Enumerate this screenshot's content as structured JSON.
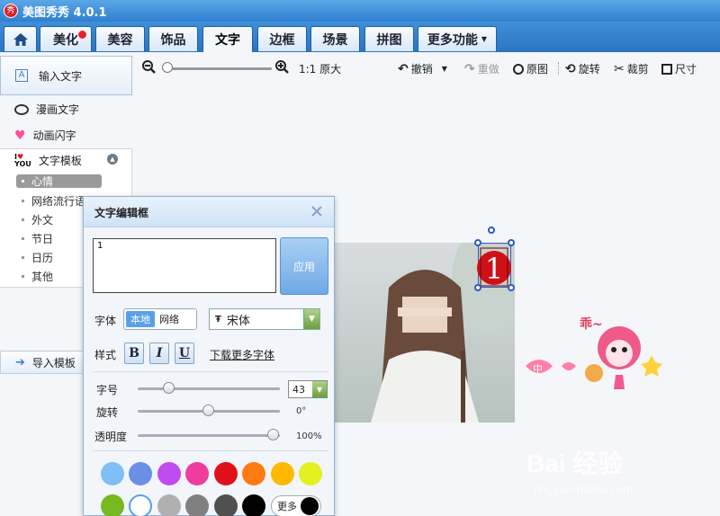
{
  "app": {
    "title": "美图秀秀 4.0.1",
    "logo_text": "秀"
  },
  "tabs": [
    {
      "label": ""
    },
    {
      "label": "美化"
    },
    {
      "label": "美容"
    },
    {
      "label": "饰品"
    },
    {
      "label": "文字"
    },
    {
      "label": "边框"
    },
    {
      "label": "场景"
    },
    {
      "label": "拼图"
    },
    {
      "label": "更多功能"
    }
  ],
  "toolbar": {
    "original_size": "1:1 原大",
    "undo": "撤销",
    "redo": "重做",
    "original": "原图",
    "rotate": "旋转",
    "crop": "裁剪",
    "resize": "尺寸",
    "zoom_level": 0.0
  },
  "left_panel": {
    "input_text": "输入文字",
    "comic_text": "漫画文字",
    "anim_text": "动画闪字",
    "template": "文字模板",
    "sub_items": [
      "心情",
      "网络流行语",
      "外文",
      "节日",
      "日历",
      "其他"
    ],
    "import_template": "导入模板"
  },
  "dialog": {
    "title": "文字编辑框",
    "text_value": "1",
    "apply": "应用",
    "font_label": "字体",
    "font_local": "本地",
    "font_net": "网络",
    "font_name": "宋体",
    "style_label": "样式",
    "bold": "B",
    "italic": "I",
    "underline": "U",
    "download_fonts": "下载更多字体",
    "size_label": "字号",
    "size_value": "43",
    "rotate_label": "旋转",
    "rotate_value": "0°",
    "opacity_label": "透明度",
    "opacity_value": "100%",
    "more": "更多",
    "colors_row1": [
      "#7fbff5",
      "#6b8fe6",
      "#c04cf0",
      "#f03c9e",
      "#e0101a",
      "#ff7a10",
      "#ffb800",
      "#e4f020"
    ],
    "colors_row2": [
      "#78b820",
      "#ffffff",
      "#b0b0b0",
      "#808080",
      "#505050",
      "#000000"
    ]
  },
  "canvas": {
    "sticker_text": "1"
  },
  "watermark": {
    "text": "Bai 经验",
    "url": "jingyan.baidu.com"
  }
}
